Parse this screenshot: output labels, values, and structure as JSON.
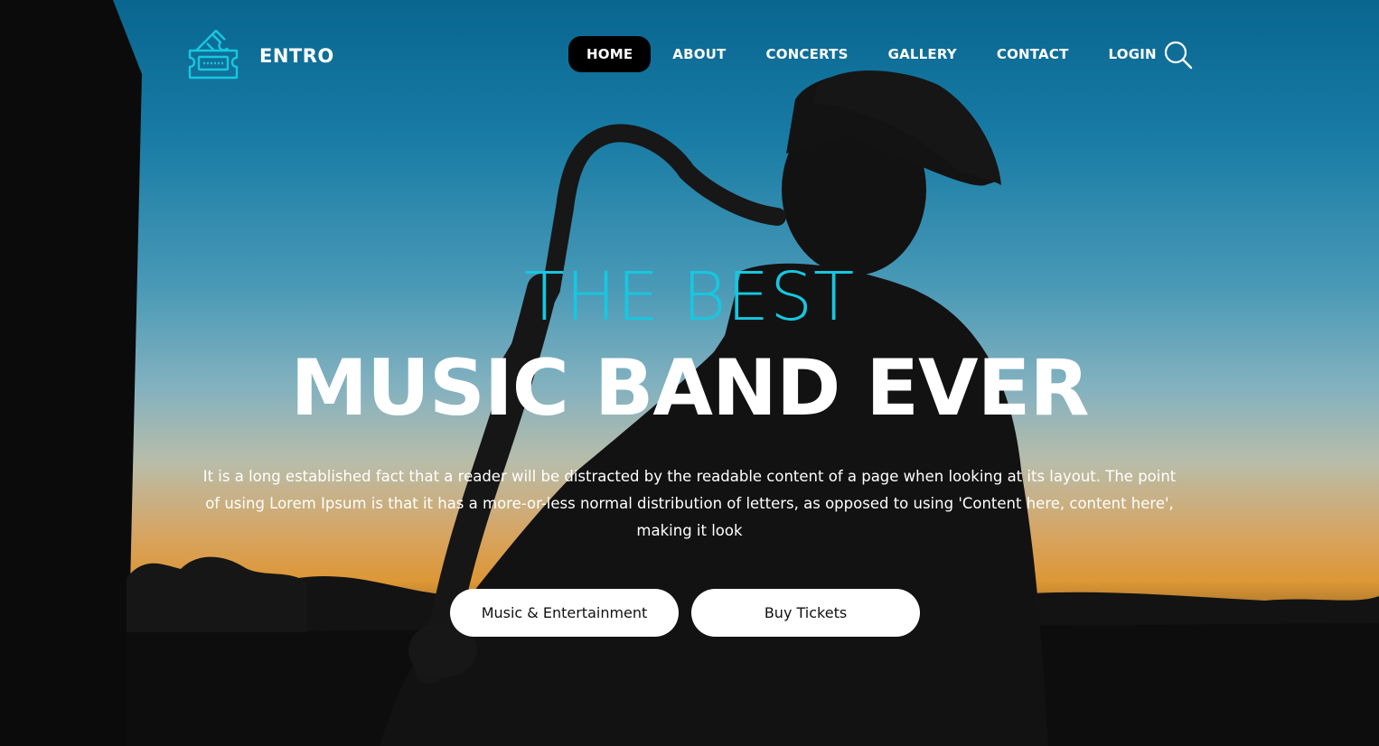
{
  "brand": {
    "name": "ENTRO",
    "icon": "ticket-icon",
    "accent": "#18c7e0"
  },
  "nav": {
    "items": [
      {
        "label": "HOME",
        "active": true
      },
      {
        "label": "ABOUT",
        "active": false
      },
      {
        "label": "CONCERTS",
        "active": false
      },
      {
        "label": "GALLERY",
        "active": false
      },
      {
        "label": "CONTACT",
        "active": false
      },
      {
        "label": "LOGIN",
        "active": false
      }
    ],
    "search_icon": "search-icon"
  },
  "hero": {
    "kicker": "THE BEST",
    "headline": "MUSIC BAND EVER",
    "description_lines": [
      "It is a long established fact that a reader will be distracted by the readable content of a page when looking at its layout. The point",
      "of using Lorem Ipsum is that it has a more-or-less normal distribution of letters, as opposed to using 'Content here, content here',",
      "making it look"
    ],
    "buttons": [
      {
        "label": "Music & Entertainment"
      },
      {
        "label": "Buy Tickets"
      }
    ]
  }
}
